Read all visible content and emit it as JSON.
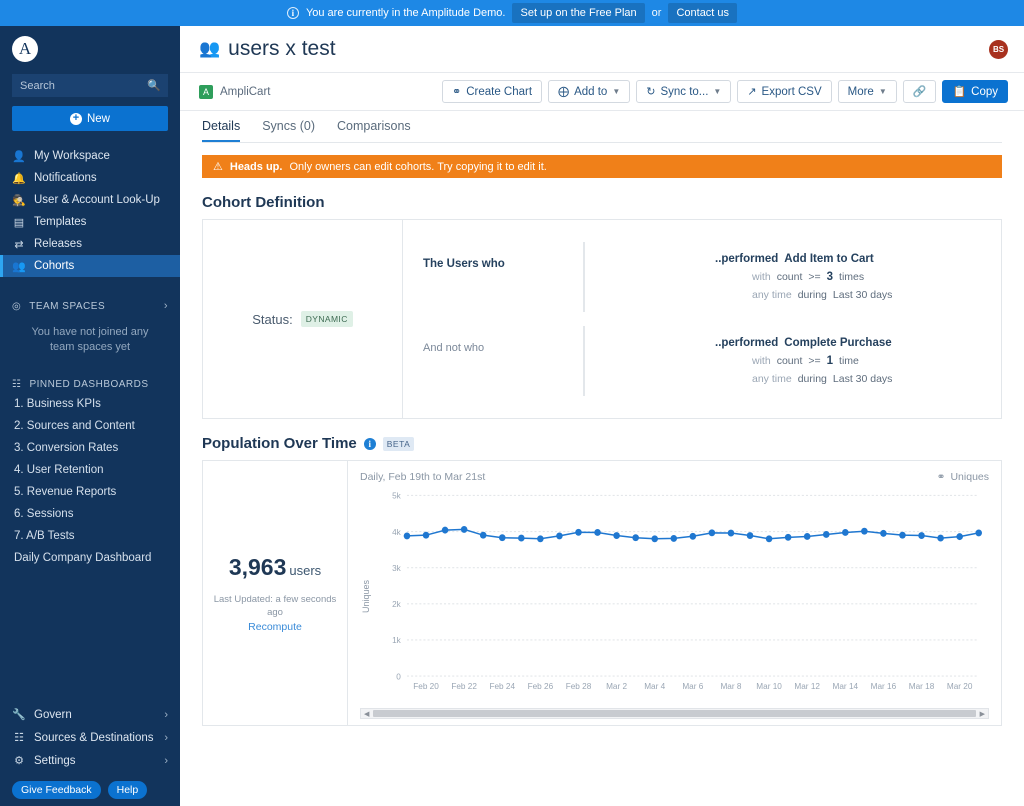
{
  "banner": {
    "icon": "info-icon",
    "message": "You are currently in the Amplitude Demo.",
    "primary_btn": "Set up on the Free Plan",
    "or": "or",
    "secondary_btn": "Contact us"
  },
  "sidebar": {
    "logo": "amplitude-logo",
    "search_placeholder": "Search",
    "new_button": "New",
    "nav": [
      {
        "label": "My Workspace",
        "icon": "person-icon",
        "active": false
      },
      {
        "label": "Notifications",
        "icon": "bell-icon",
        "active": false
      },
      {
        "label": "User & Account Look-Up",
        "icon": "person-search-icon",
        "active": false
      },
      {
        "label": "Templates",
        "icon": "templates-icon",
        "active": false
      },
      {
        "label": "Releases",
        "icon": "releases-icon",
        "active": false
      },
      {
        "label": "Cohorts",
        "icon": "cohorts-icon",
        "active": true
      }
    ],
    "team_spaces": {
      "title": "TEAM SPACES",
      "empty_text": "You have not joined any team spaces yet"
    },
    "pinned": {
      "title": "PINNED DASHBOARDS",
      "items": [
        "1. Business KPIs",
        "2. Sources and Content",
        "3. Conversion Rates",
        "4. User Retention",
        "5. Revenue Reports",
        "6. Sessions",
        "7. A/B Tests",
        "Daily Company Dashboard"
      ]
    },
    "bottom": [
      {
        "label": "Govern",
        "icon": "wrench-icon"
      },
      {
        "label": "Sources & Destinations",
        "icon": "sitemap-icon"
      },
      {
        "label": "Settings",
        "icon": "gear-icon"
      }
    ],
    "pills": [
      "Give Feedback",
      "Help"
    ]
  },
  "header": {
    "title": "users x test",
    "title_icon": "people-icon",
    "avatar_initials": "BS"
  },
  "toolbar": {
    "project_badge": "A",
    "project_name": "AmpliCart",
    "buttons": [
      {
        "label": "Create Chart",
        "icon": "chart-icon",
        "caret": false,
        "primary": false
      },
      {
        "label": "Add to",
        "icon": "plus-circle-icon",
        "caret": true,
        "primary": false
      },
      {
        "label": "Sync to...",
        "icon": "sync-icon",
        "caret": true,
        "primary": false
      },
      {
        "label": "Export CSV",
        "icon": "export-icon",
        "caret": false,
        "primary": false
      },
      {
        "label": "More",
        "icon": "",
        "caret": true,
        "primary": false
      },
      {
        "label": "",
        "icon": "link-icon",
        "caret": false,
        "primary": false
      },
      {
        "label": "Copy",
        "icon": "copy-icon",
        "caret": false,
        "primary": true
      }
    ]
  },
  "tabs": [
    {
      "label": "Details",
      "active": true
    },
    {
      "label": "Syncs (0)",
      "active": false
    },
    {
      "label": "Comparisons",
      "active": false
    }
  ],
  "alert": {
    "icon": "warning-icon",
    "bold": "Heads up.",
    "text": "Only owners can edit cohorts. Try copying it to edit it."
  },
  "cohort_definition": {
    "section_title": "Cohort Definition",
    "status_label": "Status:",
    "status_value": "DYNAMIC",
    "blocks": [
      {
        "who_label": "The Users who",
        "who_bold": true,
        "performed_label": "..performed",
        "event": "Add Item to Cart",
        "with_label": "with",
        "count_label": "count",
        "operator": ">=",
        "count_value": "3",
        "times_label": "times",
        "anytime_label": "any time",
        "during_label": "during",
        "window": "Last 30 days"
      },
      {
        "who_label": "And not who",
        "who_bold": false,
        "performed_label": "..performed",
        "event": "Complete Purchase",
        "with_label": "with",
        "count_label": "count",
        "operator": ">=",
        "count_value": "1",
        "times_label": "time",
        "anytime_label": "any time",
        "during_label": "during",
        "window": "Last 30 days"
      }
    ]
  },
  "population": {
    "section_title": "Population Over Time",
    "info_icon": "info-icon",
    "beta_badge": "BETA",
    "count": "3,963",
    "count_unit": "users",
    "last_updated": "Last Updated: a few seconds ago",
    "recompute": "Recompute",
    "accent_color": "#1F77D0"
  },
  "chart_data": {
    "type": "line",
    "title": "Daily, Feb 19th to Mar 21st",
    "legend": [
      "Uniques"
    ],
    "legend_position": "top-right",
    "legend_icon": "chart-icon",
    "xlabel": "",
    "ylabel": "Uniques",
    "ylim": [
      0,
      5000
    ],
    "ytick_labels": [
      "5k",
      "4k",
      "3k",
      "2k",
      "1k",
      "0"
    ],
    "yticks": [
      5000,
      4000,
      3000,
      2000,
      1000,
      0
    ],
    "grid": true,
    "xtick_labels": [
      "Feb 20",
      "Feb 22",
      "Feb 24",
      "Feb 26",
      "Feb 28",
      "Mar 2",
      "Mar 4",
      "Mar 6",
      "Mar 8",
      "Mar 10",
      "Mar 12",
      "Mar 14",
      "Mar 16",
      "Mar 18",
      "Mar 20"
    ],
    "x": [
      "Feb 19",
      "Feb 20",
      "Feb 21",
      "Feb 22",
      "Feb 23",
      "Feb 24",
      "Feb 25",
      "Feb 26",
      "Feb 27",
      "Feb 28",
      "Mar 1",
      "Mar 2",
      "Mar 3",
      "Mar 4",
      "Mar 5",
      "Mar 6",
      "Mar 7",
      "Mar 8",
      "Mar 9",
      "Mar 10",
      "Mar 11",
      "Mar 12",
      "Mar 13",
      "Mar 14",
      "Mar 15",
      "Mar 16",
      "Mar 17",
      "Mar 18",
      "Mar 19",
      "Mar 20",
      "Mar 21"
    ],
    "series": [
      {
        "name": "Uniques",
        "color": "#1F77D0",
        "values": [
          3880,
          3900,
          4040,
          4060,
          3900,
          3830,
          3820,
          3800,
          3880,
          3980,
          3975,
          3890,
          3830,
          3800,
          3810,
          3870,
          3965,
          3960,
          3890,
          3800,
          3840,
          3865,
          3920,
          3975,
          4010,
          3950,
          3900,
          3890,
          3820,
          3860,
          3963
        ]
      }
    ],
    "scrollbar": true
  }
}
